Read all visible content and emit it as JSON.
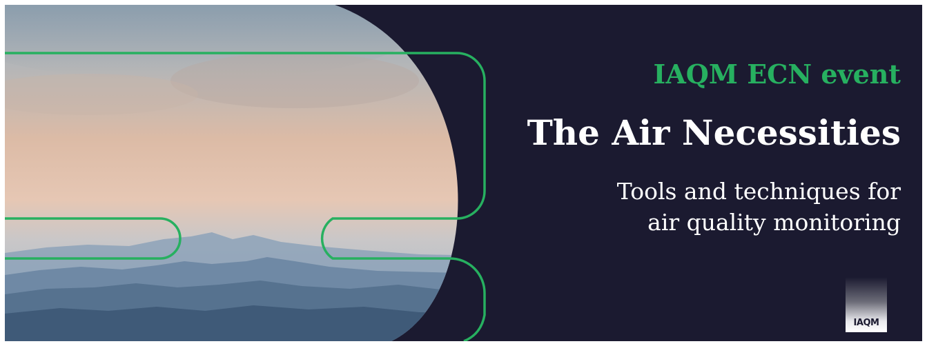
{
  "banner": {
    "eyebrow": "IAQM ECN event",
    "title": "The Air Necessities",
    "subtitle_lines": [
      "Tools and techniques for",
      "air quality monitoring"
    ],
    "logo_text": "IAQM"
  },
  "colors": {
    "background": "#1b1a30",
    "accent_green": "#27b060",
    "title_text": "#ffffff"
  },
  "imagery": {
    "photo_subject": "misty-mountain-landscape",
    "decoration": "green-outline-rounded-tubes"
  }
}
